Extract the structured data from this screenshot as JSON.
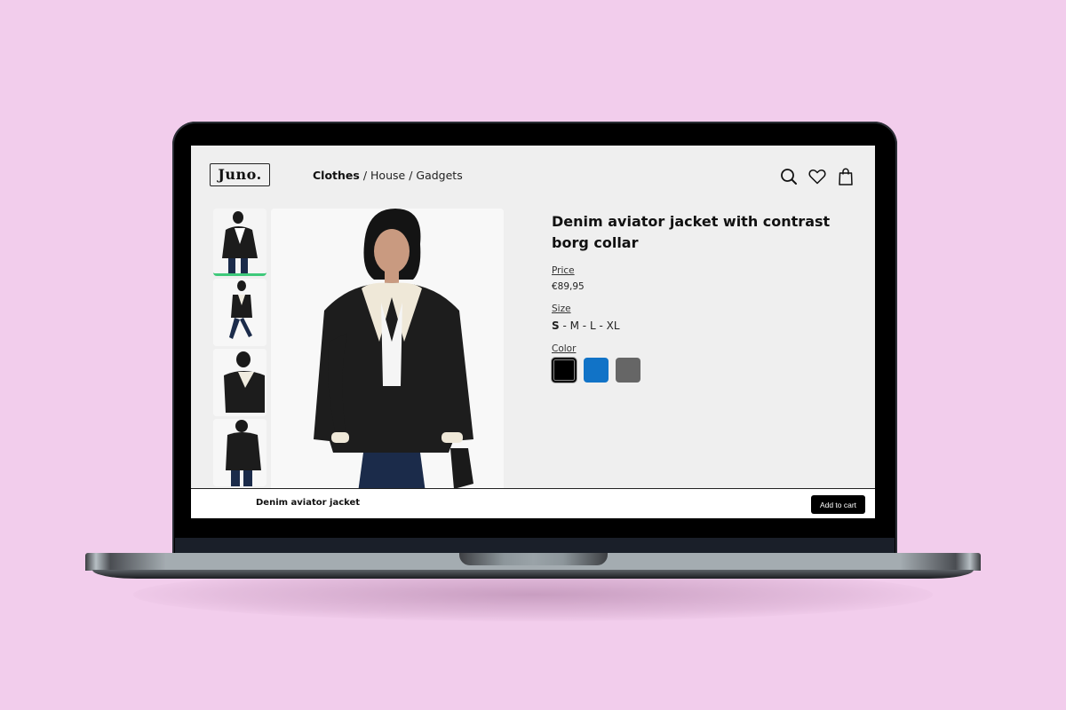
{
  "header": {
    "logo": "Juno.",
    "nav": [
      {
        "label": "Clothes",
        "active": true
      },
      {
        "label": "House",
        "active": false
      },
      {
        "label": "Gadgets",
        "active": false
      }
    ],
    "separator": "/",
    "icons": [
      "search-icon",
      "heart-icon",
      "shopping-bag-icon"
    ]
  },
  "gallery": {
    "thumbnail_count": 4,
    "active_thumbnail": 0,
    "active_color": "#3ec97a"
  },
  "product": {
    "title": "Denim aviator jacket with contrast borg collar",
    "price_label": "Price",
    "price": "€89,95",
    "size_label": "Size",
    "sizes": [
      "S",
      "M",
      "L",
      "XL"
    ],
    "selected_size": "S",
    "size_separator": " - ",
    "color_label": "Color",
    "colors": [
      {
        "name": "black",
        "hex": "#000000",
        "selected": true
      },
      {
        "name": "blue",
        "hex": "#1173c7",
        "selected": false
      },
      {
        "name": "grey",
        "hex": "#666666",
        "selected": false
      }
    ]
  },
  "sticky_bar": {
    "title": "Denim aviator jacket",
    "add_to_cart": "Add to cart"
  }
}
